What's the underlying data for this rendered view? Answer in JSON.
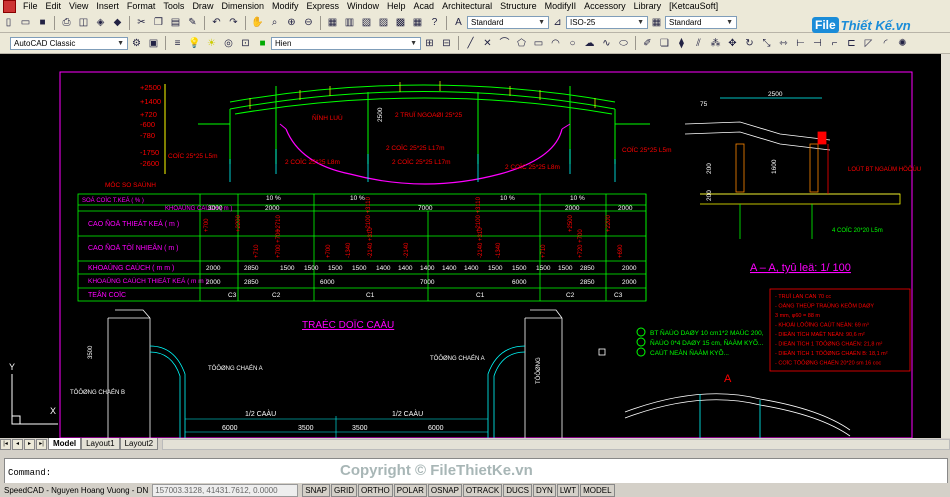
{
  "menu": [
    "File",
    "Edit",
    "View",
    "Insert",
    "Format",
    "Tools",
    "Draw",
    "Dimension",
    "Modify",
    "Express",
    "Window",
    "Help",
    "Acad",
    "Architectural",
    "Structure",
    "ModifyII",
    "Accessory",
    "Library",
    "[KetcauSoft]"
  ],
  "toolbar1": {
    "text_style": "Standard",
    "dim_style": "ISO-25",
    "table_style": "Standard"
  },
  "toolbar2": {
    "workspace": "AutoCAD Classic",
    "layer": "Hien"
  },
  "logo": {
    "file": "File",
    "rest": "Thiết Kế.vn"
  },
  "drawing": {
    "levels": [
      "+2500",
      "+1400",
      "+720",
      "-600",
      "-780",
      "-1750",
      "-2600"
    ],
    "muc_so_sanh": "MÖC SO SAÙNH",
    "row_labels": [
      "SOÁ COÏC T.KEÁ ( % )",
      "KHOAÛNG CAÙCH ( m )",
      "CAO ÑOÄ THIEÁT KEÁ ( m )",
      "CAO ÑOÄ TÖÏ NHIEÂN ( m )",
      "KHOAÛNG CAÙCH ( m m )",
      "KHOAÛNG CAÙCH THIEÁT KEÁ ( m m )",
      "TEÂN COÏC"
    ],
    "khoang_cach_top": [
      "3000",
      "2000",
      "7000",
      "2000",
      "2000"
    ],
    "khoang_cach_mm": [
      "2000",
      "2850",
      "1500",
      "1500",
      "1500",
      "1500",
      "1400",
      "1400",
      "1400",
      "1400",
      "1400",
      "1500",
      "1500",
      "1500",
      "1500",
      "2850",
      "2000"
    ],
    "khoang_cach_tk": [
      "2000",
      "2850",
      "6000",
      "7000",
      "6000",
      "2850",
      "2000"
    ],
    "ten_coc": [
      "C3",
      "C2",
      "C1",
      "C1",
      "C2",
      "C3"
    ],
    "slopes": [
      "10 %",
      "10 %",
      "10 %",
      "10 %"
    ],
    "dims_bottom": [
      "6000",
      "3500",
      "3500",
      "6000"
    ],
    "half_labels": [
      "1/2 CAÀU",
      "1/2 CAÀU"
    ],
    "beam_labels": [
      "ÑÍNH LUÙ",
      "2 TRUÏ NGOAØI 25*25",
      "2500",
      "2 COÏC 25*25 L17m",
      "2 COÏC 25*25 L17m",
      "2 COÏC 25*25 L8m",
      "2 COÏC 25*25 L8m",
      "COÏC 25*25 L5m",
      "COÏC 25*25 L5m"
    ],
    "title_profile": "TRAÉC DOÏC CAÀU",
    "section_title": "A – A, tyû leä: 1/ 100",
    "section_dims": [
      "2500",
      "75",
      "1600",
      "200",
      "200"
    ],
    "section_labels": [
      "LOÙT BT NGAÙM HÖÔÙU",
      "4 COÏC 20*20 L5m"
    ],
    "legend_notes": [
      "BT ÑAÙO DAØY 10 cm1*2 MAÙC 200,",
      "ÑAÙO 0*4 DAØY 15 cm, ÑAÀM KYÕ...",
      "CAÙT NEÀN ÑAÀM KYÕ..."
    ],
    "red_notes": [
      "- TRUÏ LAN CAN 70 cc",
      "- OÁNG THEÙP TRAÙNG KEÕM DAØY",
      "3 mm, φ60 = 88 m",
      "- KHOÁI LÖÔÏNG CAÙT NEÀN: 69 m³",
      "- DIEÄN TÍCH MAËT NEÀN: 90,6 m²",
      "- DIEÄN TÍCH 1 TÖÔØNG CHAÉN: 21,8 m²",
      "- DIEÄN TÍCH 1 TÖÔØNG CHAÉN B: 18,1 m²",
      "- COÏC TÖÔØNG CHAÉN 20*20 sm 16 coc"
    ],
    "wall_labels": [
      "TÖÔØNG CHAÉN A",
      "TÖÔØNG CHAÉN A",
      "TÖÔØNG CHAÉN B",
      "TÖÔØNG"
    ],
    "section_mark": "A",
    "ucs_y": "Y",
    "ucs_x": "X",
    "dim_3500": "3500"
  },
  "tabs": [
    "Model",
    "Layout1",
    "Layout2"
  ],
  "command": {
    "label": "Command:"
  },
  "watermark": "Copyright © FileThietKe.vn",
  "status": {
    "user": "SpeedCAD - Nguyen Hoang Vuong - DN",
    "coords": "157003.3128, 41431.7612, 0.0000",
    "buttons": [
      "SNAP",
      "GRID",
      "ORTHO",
      "POLAR",
      "OSNAP",
      "OTRACK",
      "DUCS",
      "DYN",
      "LWT",
      "MODEL"
    ]
  }
}
